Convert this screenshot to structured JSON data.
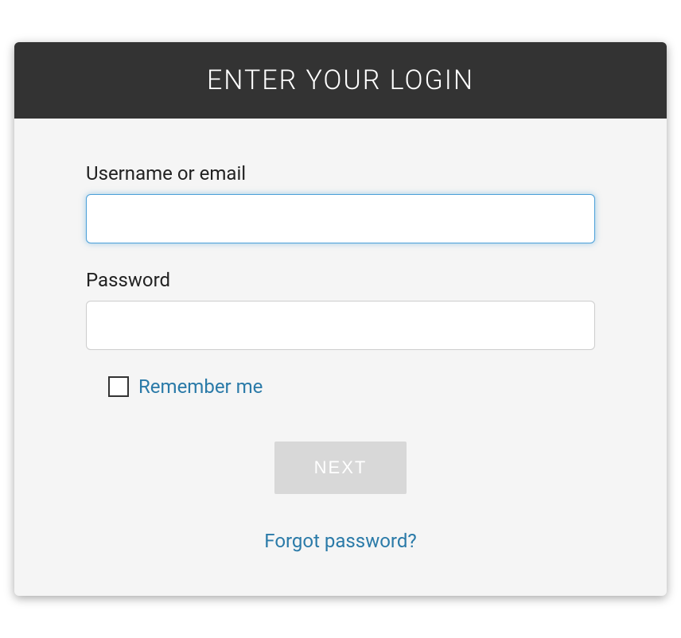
{
  "header": {
    "title": "ENTER YOUR LOGIN"
  },
  "fields": {
    "username": {
      "label": "Username or email",
      "value": ""
    },
    "password": {
      "label": "Password",
      "value": ""
    }
  },
  "remember": {
    "label": "Remember me",
    "checked": false
  },
  "actions": {
    "next_label": "NEXT",
    "forgot_label": "Forgot password?"
  },
  "colors": {
    "header_bg": "#333333",
    "link": "#2a7aa8",
    "focus": "#4a9fd8"
  }
}
